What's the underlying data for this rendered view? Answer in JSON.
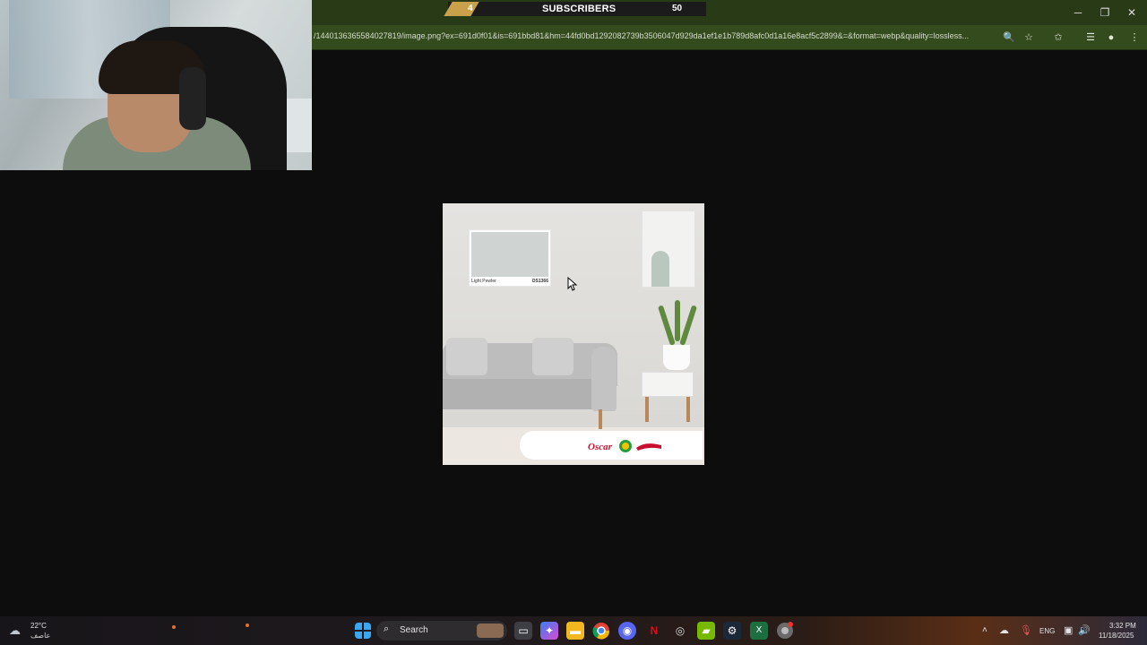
{
  "stream_overlay": {
    "subscriber_count": "4",
    "subscriber_label": "SUBSCRIBERS",
    "subscriber_goal": "50"
  },
  "browser": {
    "url": "/1440136365584027819/image.png?ex=691d0f01&is=691bbd81&hm=44fd0bd1292082739b3506047d929da1ef1e1b789d8afc0d1a16e8acf5c2899&=&format=webp&quality=lossless...",
    "window_controls": [
      "─",
      "❐",
      "✕"
    ],
    "address_icons": [
      "zoom-icon",
      "bookmark-star-icon",
      "favorites-icon",
      "tab-search-icon",
      "profile-icon",
      "menu-icon"
    ]
  },
  "image": {
    "swatch_name": "Light Pewter",
    "swatch_code": "OS1366",
    "colors": {
      "swatch": "#cfd3d1",
      "wall": "#e4e3e0",
      "sofa": "#bdbdbd",
      "plant": "#5f8a3e"
    }
  },
  "taskbar": {
    "weather_temp": "22°C",
    "weather_cond": "عاصف",
    "search_label": "Search",
    "language": "ENG",
    "time": "3:32 PM",
    "date": "11/18/2025",
    "pinned_icons": [
      "windows-start-icon",
      "task-view-icon",
      "copilot-icon",
      "file-explorer-icon",
      "chrome-icon",
      "discord-icon",
      "netflix-icon",
      "obs-icon",
      "nvidia-icon",
      "steam-icon",
      "excel-icon",
      "chrome-alt-icon"
    ]
  }
}
